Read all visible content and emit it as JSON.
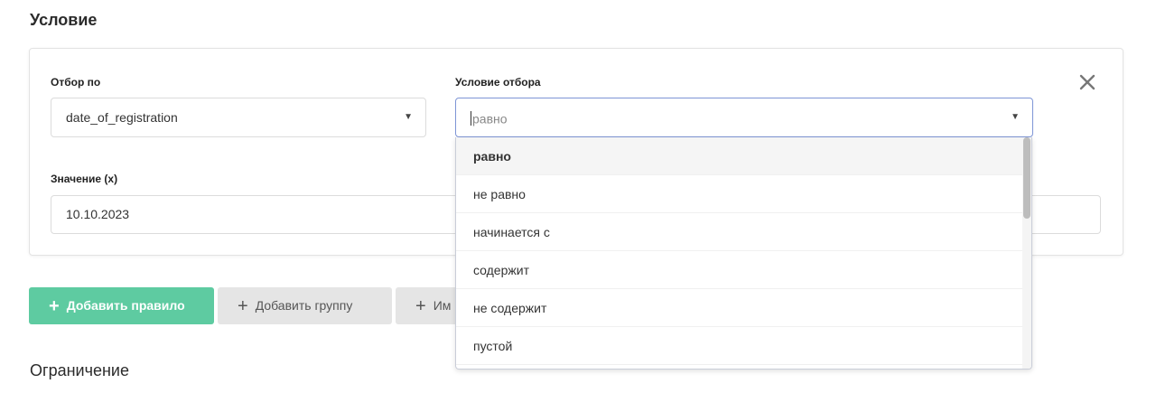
{
  "section": {
    "condition_title": "Условие",
    "limit_title": "Ограничение"
  },
  "filter_by": {
    "label": "Отбор по",
    "value": "date_of_registration"
  },
  "filter_condition": {
    "label": "Условие отбора",
    "placeholder": "равно",
    "options": [
      "равно",
      "не равно",
      "начинается с",
      "содержит",
      "не содержит",
      "пустой"
    ],
    "active_option": "равно"
  },
  "value_field": {
    "label": "Значение (x)",
    "value": "10.10.2023"
  },
  "buttons": {
    "add_rule": "Добавить правило",
    "add_group": "Добавить группу",
    "import": "Им"
  },
  "colors": {
    "accent_green": "#5ecba1",
    "focus_border": "#7e95d6",
    "secondary_button": "#e5e5e5"
  },
  "icons": {
    "close": "close-icon",
    "caret": "chevron-down-icon",
    "plus": "plus-icon"
  }
}
